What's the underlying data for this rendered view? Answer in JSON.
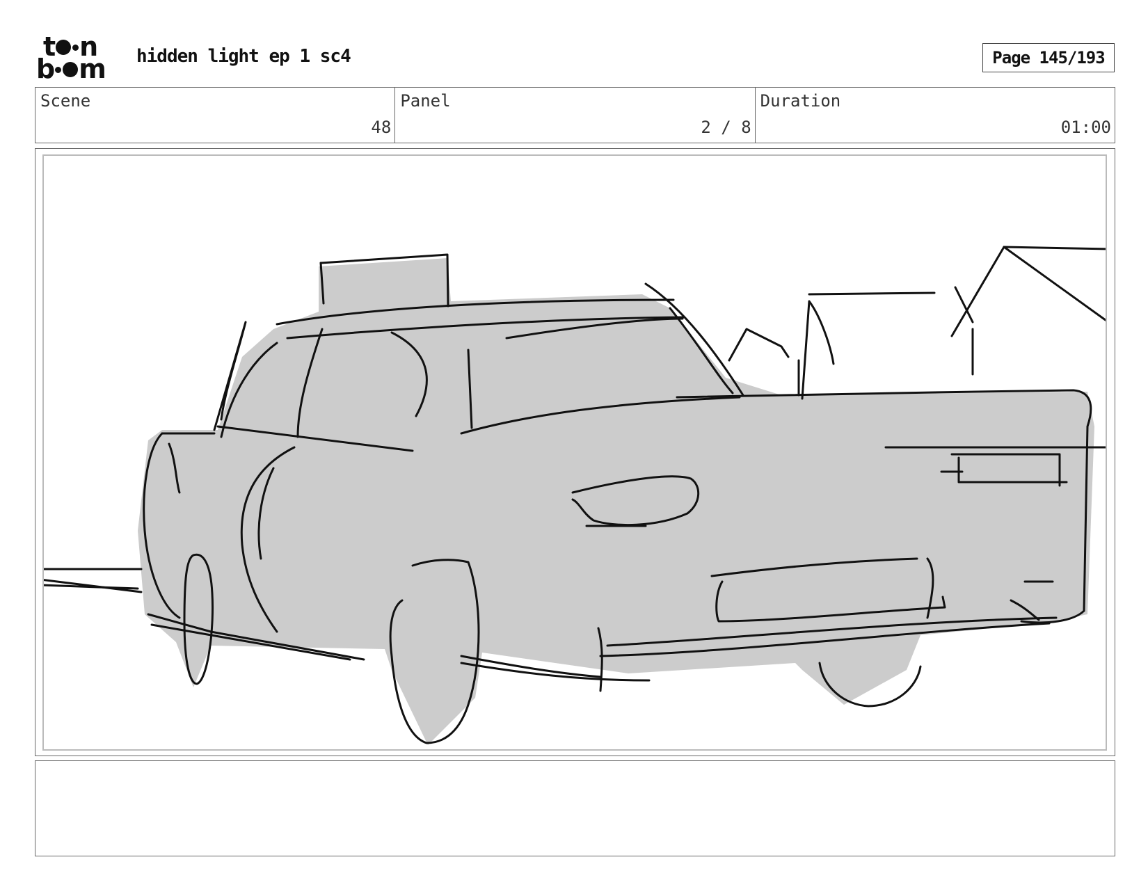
{
  "header": {
    "logo": {
      "line1": [
        "t",
        "n"
      ],
      "line2": [
        "b",
        "m"
      ],
      "alt": "toon boom"
    },
    "title": "hidden light ep 1 sc4",
    "page": "Page 145/193"
  },
  "info": {
    "scene_label": "Scene",
    "scene_value": "48",
    "panel_label": "Panel",
    "panel_value": "2 / 8",
    "duration_label": "Duration",
    "duration_value": "01:00"
  },
  "drawing": {
    "subject": "car",
    "fill_color": "#cccccc",
    "line_color": "#111111"
  },
  "notes": {
    "text": ""
  }
}
